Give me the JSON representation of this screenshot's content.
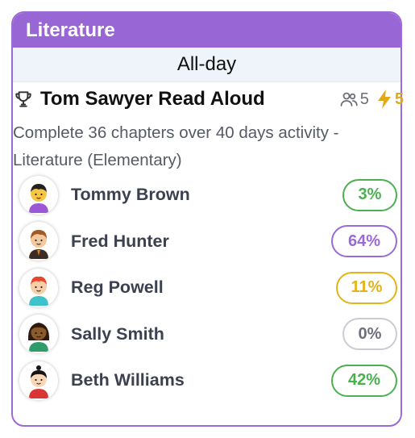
{
  "card": {
    "subject": "Literature",
    "period": "All-day",
    "activity": {
      "title": "Tom Sawyer Read Aloud",
      "participants_count": "5",
      "points": "5",
      "description": "Complete 36 chapters over 40 days activity - Literature (Elementary)"
    },
    "students": [
      {
        "name": "Tommy Brown",
        "progress": "3%",
        "color": "#4caf50",
        "avatar": "boy-black-hair"
      },
      {
        "name": "Fred Hunter",
        "progress": "64%",
        "color": "#9a6ad8",
        "avatar": "boy-brown-hair"
      },
      {
        "name": "Reg Powell",
        "progress": "11%",
        "color": "#e2b419",
        "avatar": "boy-red-hair"
      },
      {
        "name": "Sally Smith",
        "progress": "0%",
        "color": "#c9ccd2",
        "avatar": "girl-dark-skin"
      },
      {
        "name": "Beth Williams",
        "progress": "42%",
        "color": "#4caf50",
        "avatar": "girl-black-hair"
      }
    ]
  },
  "colors": {
    "accent": "#9966d6",
    "points": "#e2aa18",
    "period_bg": "#eff3fa"
  }
}
